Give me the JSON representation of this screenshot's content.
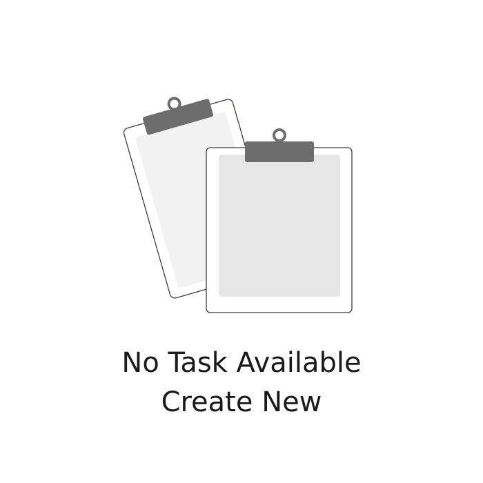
{
  "empty_state": {
    "title": "No Task Available",
    "action_label": "Create New",
    "illustration_icon": "clipboards-icon"
  },
  "colors": {
    "background": "#ffffff",
    "text": "#1a1a1a",
    "clip": "#6d6d6d",
    "outline": "#3a3a4a",
    "back_paper": "#f2f2f2",
    "front_paper": "#e6e6e6"
  }
}
